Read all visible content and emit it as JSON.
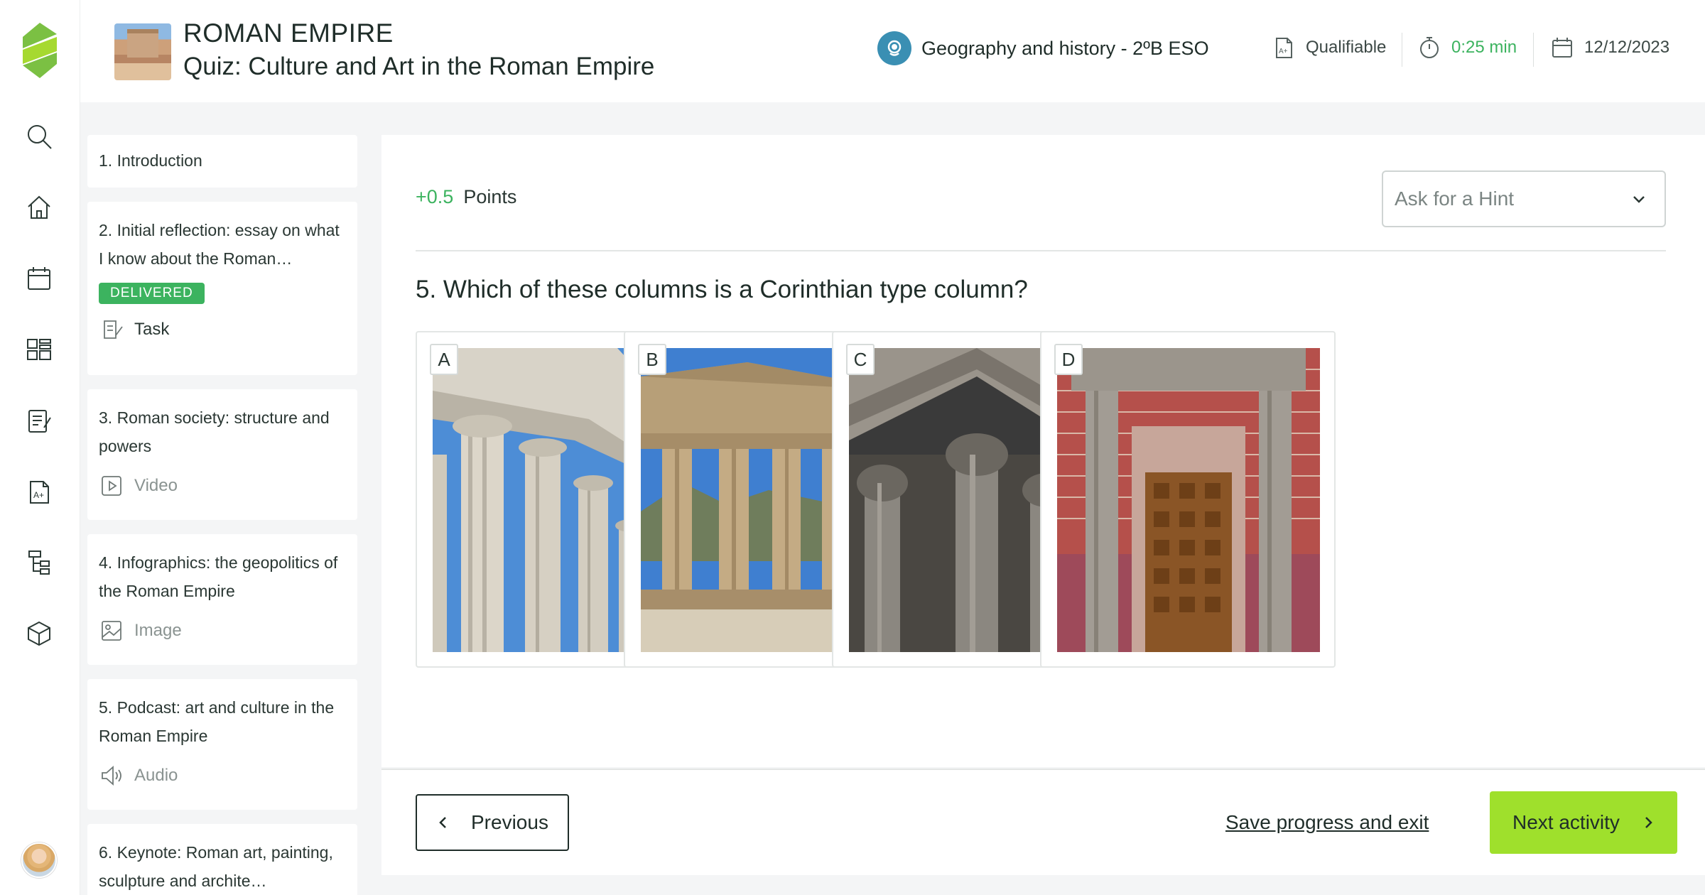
{
  "header": {
    "course_title": "ROMAN EMPIRE",
    "quiz_title": "Quiz: Culture and Art in the Roman Empire",
    "subject": "Geography and history - 2ºB ESO",
    "qualifiable": "Qualifiable",
    "timer": "0:25 min",
    "date": "12/12/2023",
    "timer_color": "#3cb35f"
  },
  "rail": {
    "icons": [
      "search-icon",
      "home-icon",
      "calendar-icon",
      "dashboard-icon",
      "task-list-icon",
      "grades-icon",
      "tree-icon",
      "cube-icon"
    ]
  },
  "sidebar": {
    "items": [
      {
        "title": "1. Introduction"
      },
      {
        "title": "2. Initial reflection: essay on what I know about the Roman…",
        "badge": "DELIVERED",
        "type": "Task"
      },
      {
        "title": "3. Roman society: structure and powers",
        "type": "Video"
      },
      {
        "title": "4. Infographics: the geopolitics of the Roman Empire",
        "type": "Image"
      },
      {
        "title": "5. Podcast: art and culture in the Roman Empire",
        "type": "Audio"
      },
      {
        "title": "6. Keynote: Roman art, painting, sculpture and archite…"
      }
    ]
  },
  "main": {
    "points_value": "+0.5",
    "points_label": "Points",
    "hint_placeholder": "Ask for a Hint",
    "question": "5. Which of these columns is a Corinthian type column?",
    "options": [
      {
        "letter": "A",
        "image": "ionic-columns-photo"
      },
      {
        "letter": "B",
        "image": "doric-temple-photo"
      },
      {
        "letter": "C",
        "image": "corinthian-portico-photo"
      },
      {
        "letter": "D",
        "image": "doorway-columns-photo"
      }
    ]
  },
  "footer": {
    "previous": "Previous",
    "save_exit": "Save progress and exit",
    "next": "Next activity"
  },
  "colors": {
    "accent_green": "#9fe02c",
    "success_green": "#3cb35f",
    "subject_blue": "#3a8fb3"
  }
}
